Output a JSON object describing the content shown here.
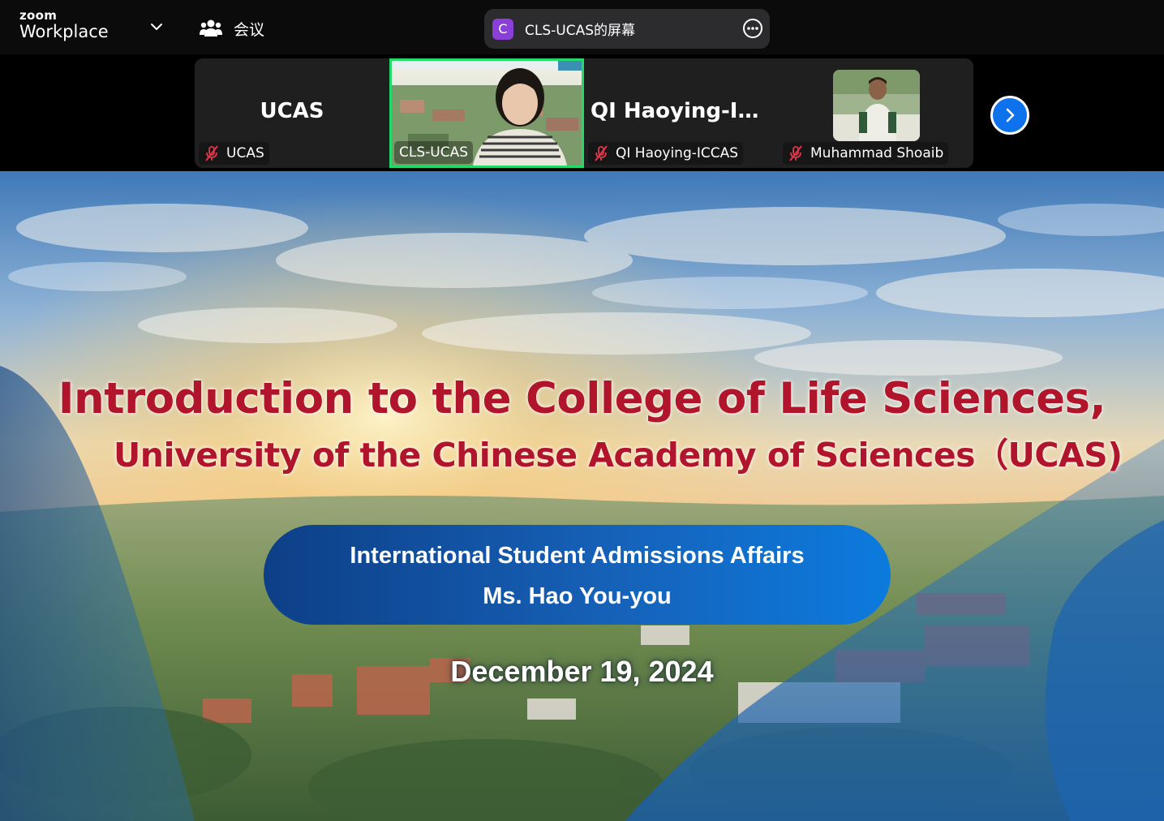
{
  "app": {
    "logo_small": "zoom",
    "logo_large": "Workplace",
    "meeting_label": "会议"
  },
  "share": {
    "avatar_letter": "C",
    "title": "CLS-UCAS的屏幕",
    "avatar_color": "#8b3fd9"
  },
  "participants": [
    {
      "tile_name": "UCAS",
      "label": "UCAS",
      "muted": true,
      "video": false
    },
    {
      "tile_name": "",
      "label": "CLS-UCAS",
      "muted": false,
      "video": true,
      "active_speaker": true
    },
    {
      "tile_name": "QI  Haoying-ICC...",
      "label": "QI Haoying-ICCAS",
      "muted": true,
      "video": false
    },
    {
      "tile_name": "",
      "label": "Muhammad Shoaib",
      "muted": true,
      "video": true
    }
  ],
  "slide": {
    "title_line1": "Introduction to the College of Life Sciences,",
    "title_line2": "University of the Chinese Academy of Sciences（UCAS)",
    "pill_line1": "International Student Admissions Affairs",
    "pill_line2": "Ms. Hao You-you",
    "date": "December 19, 2024"
  },
  "colors": {
    "accent_blue": "#0e72ed",
    "active_speaker_border": "#23d96a",
    "title_red": "#b0152b",
    "muted_red": "#e0374b"
  },
  "icons": {
    "meeting": "participants-icon",
    "chevron": "chevron-down-icon",
    "more": "more-options-icon",
    "next": "chevron-right-icon",
    "mic": "mic-off-icon"
  }
}
